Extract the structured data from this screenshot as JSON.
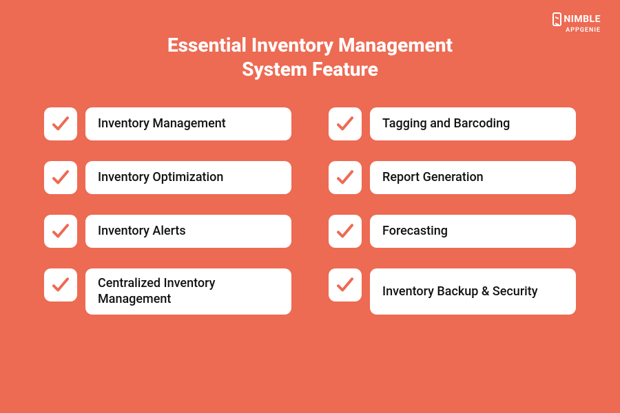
{
  "logo": {
    "brand": "NIMBLE",
    "sub": "APPGENIE"
  },
  "title_line1": "Essential Inventory Management",
  "title_line2": "System Feature",
  "features": {
    "left": [
      "Inventory Management",
      "Inventory Optimization",
      "Inventory Alerts",
      "Centralized Inventory Management"
    ],
    "right": [
      "Tagging and Barcoding",
      "Report Generation",
      "Forecasting",
      "Inventory Backup & Security"
    ]
  },
  "colors": {
    "background": "#ed6a53",
    "card": "#ffffff",
    "check": "#ed6a53"
  }
}
